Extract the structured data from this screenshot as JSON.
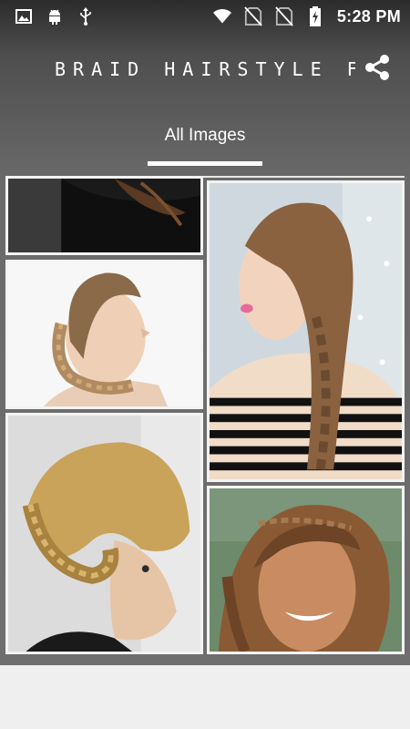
{
  "status_bar": {
    "time": "5:28 PM",
    "left_icons": [
      "image-icon",
      "android-icon",
      "usb-icon"
    ],
    "right_icons": [
      "wifi-icon",
      "no-sim-icon",
      "no-sim-icon",
      "battery-charging-icon"
    ]
  },
  "toolbar": {
    "title": "BRAID HAIRSTYLE FOR...",
    "share_icon": "share-icon"
  },
  "tabs": [
    {
      "label": "All Images",
      "selected": true
    }
  ],
  "colors": {
    "header_dark": "#2b2b2b",
    "header_mid": "#6a6a6a",
    "indicator": "#ffffff",
    "tile_border": "#f3f3f3",
    "bottom_bar": "#efefef"
  },
  "images": [
    {
      "name": "braid-photo-1"
    },
    {
      "name": "braid-photo-2"
    },
    {
      "name": "braid-photo-3"
    },
    {
      "name": "braid-photo-4"
    },
    {
      "name": "braid-photo-5"
    }
  ]
}
